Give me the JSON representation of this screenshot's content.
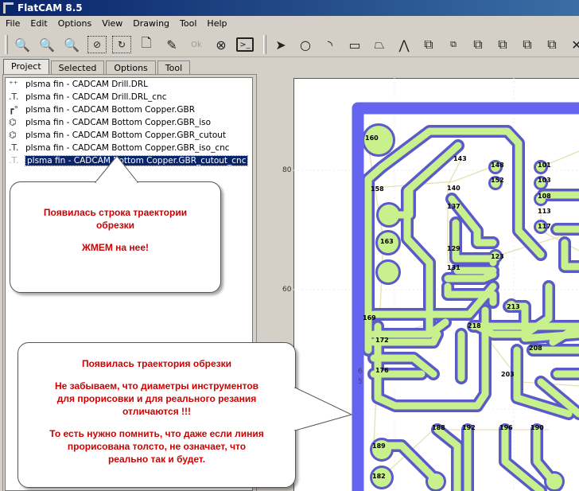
{
  "window": {
    "title": "FlatCAM 8.5"
  },
  "menu": [
    "File",
    "Edit",
    "Options",
    "View",
    "Drawing",
    "Tool",
    "Help"
  ],
  "toolbar": {
    "left_icons": [
      "zoom-fit-icon",
      "zoom-out-icon",
      "zoom-in-icon",
      "clear-plot-icon",
      "replot-icon",
      "new-project-icon",
      "edit-geometry-icon",
      "update-geometry-icon",
      "delete-object-icon",
      "shell-icon"
    ],
    "draw_icons": [
      "select-icon",
      "circle-icon",
      "arc-icon",
      "rectangle-icon",
      "polygon-icon",
      "path-icon",
      "move-icon",
      "copy-icon",
      "union-icon",
      "intersection-icon",
      "subtract-icon",
      "cut-icon",
      "delete-shape-icon"
    ]
  },
  "tabs": [
    "Project",
    "Selected",
    "Options",
    "Tool"
  ],
  "project_items": [
    {
      "icon": "excellon-icon",
      "label": "plsma fin - CADCAM Drill.DRL"
    },
    {
      "icon": "cnc-icon",
      "label": "plsma fin - CADCAM Drill.DRL_cnc"
    },
    {
      "icon": "gerber-icon",
      "label": "plsma fin - CADCAM Bottom Copper.GBR"
    },
    {
      "icon": "geometry-icon",
      "label": "plsma fin - CADCAM Bottom Copper.GBR_iso"
    },
    {
      "icon": "geometry-icon",
      "label": "plsma fin - CADCAM Bottom Copper.GBR_cutout"
    },
    {
      "icon": "cnc-icon",
      "label": "plsma fin - CADCAM Bottom Copper.GBR_iso_cnc"
    },
    {
      "icon": "cnc-icon",
      "label": "plsma fin - CADCAM Bottom Copper.GBR_cutout_cnc",
      "selected": true
    }
  ],
  "canvas": {
    "y_ticks": [
      "80",
      "60"
    ],
    "side_labels": [
      "6",
      "5"
    ],
    "pad_labels": [
      "160",
      "158",
      "143",
      "148",
      "152",
      "140",
      "137",
      "129",
      "123",
      "131",
      "163",
      "101",
      "103",
      "108",
      "113",
      "117",
      "169",
      "172",
      "176",
      "213",
      "218",
      "208",
      "203",
      "188",
      "192",
      "196",
      "190",
      "189",
      "182"
    ]
  },
  "callouts": {
    "first": {
      "line1": "Появилась строка траектории",
      "line2": "обрезки",
      "line3": "ЖМЕМ на нее!"
    },
    "second": {
      "line1": "Появилась траектория обрезки",
      "line2": "Не забываем, что диаметры инструментов",
      "line3": "для прорисовки и для реального резания",
      "line4": "отличаются !!!",
      "line5": "То есть нужно помнить, что даже если линия",
      "line6": "прорисована толсто, не означает, что",
      "line7": "реально так и будет."
    }
  },
  "colors": {
    "trace_fill": "#c8f08c",
    "trace_outline": "#5a5ac8",
    "board_outline": "#6464f0",
    "selection": "#0a246a",
    "callout_text": "#d00000"
  }
}
